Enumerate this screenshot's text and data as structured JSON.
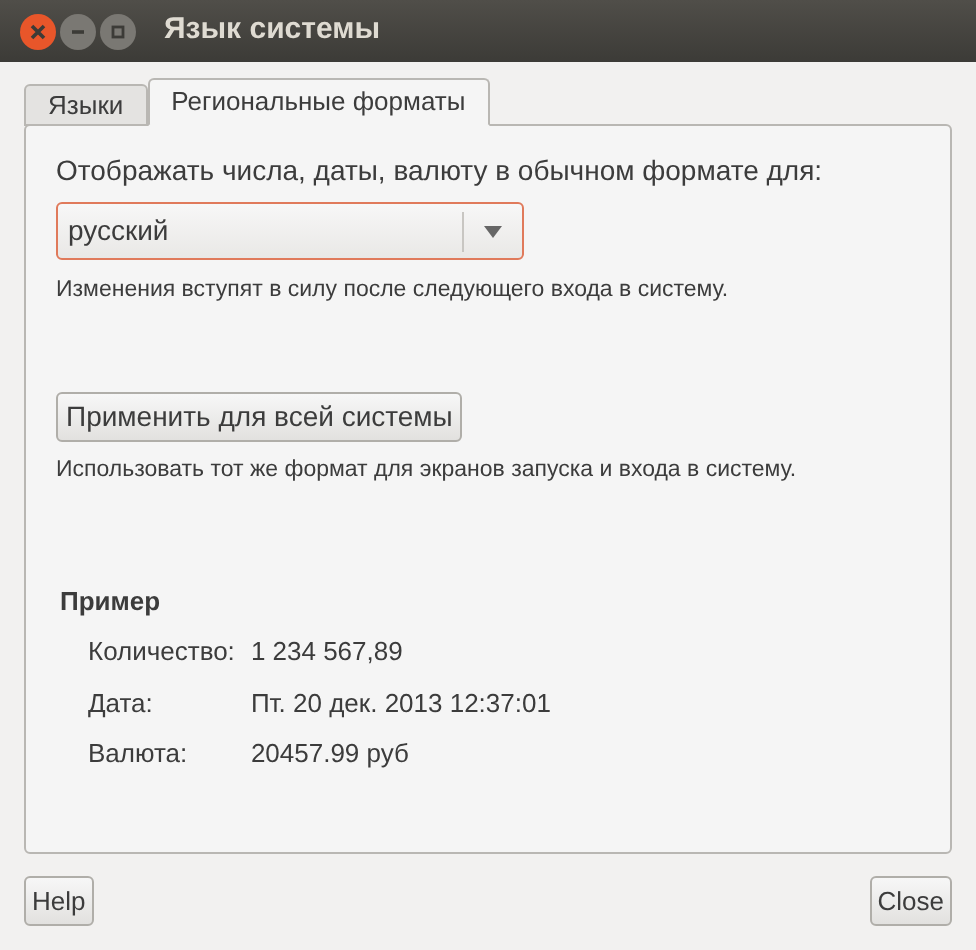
{
  "window": {
    "title": "Язык системы"
  },
  "tabs": [
    {
      "label": "Языки",
      "selected": false
    },
    {
      "label": "Региональные форматы",
      "selected": true
    }
  ],
  "format_label": "Отображать числа, даты, валюту в обычном формате для:",
  "format_select": {
    "value": "русский"
  },
  "format_note": "Изменения вступят в силу после следующего входа в систему.",
  "apply_button": "Применить для всей системы",
  "apply_note": "Использовать тот же формат для экранов запуска и входа в систему.",
  "example": {
    "title": "Пример",
    "rows": [
      {
        "label": "Количество:",
        "value": "1 234 567,89"
      },
      {
        "label": "Дата:",
        "value": "Пт. 20 дек. 2013 12:37:01"
      },
      {
        "label": "Валюта:",
        "value": "20457.99 руб"
      }
    ]
  },
  "buttons": {
    "help": "Help",
    "close": "Close"
  }
}
